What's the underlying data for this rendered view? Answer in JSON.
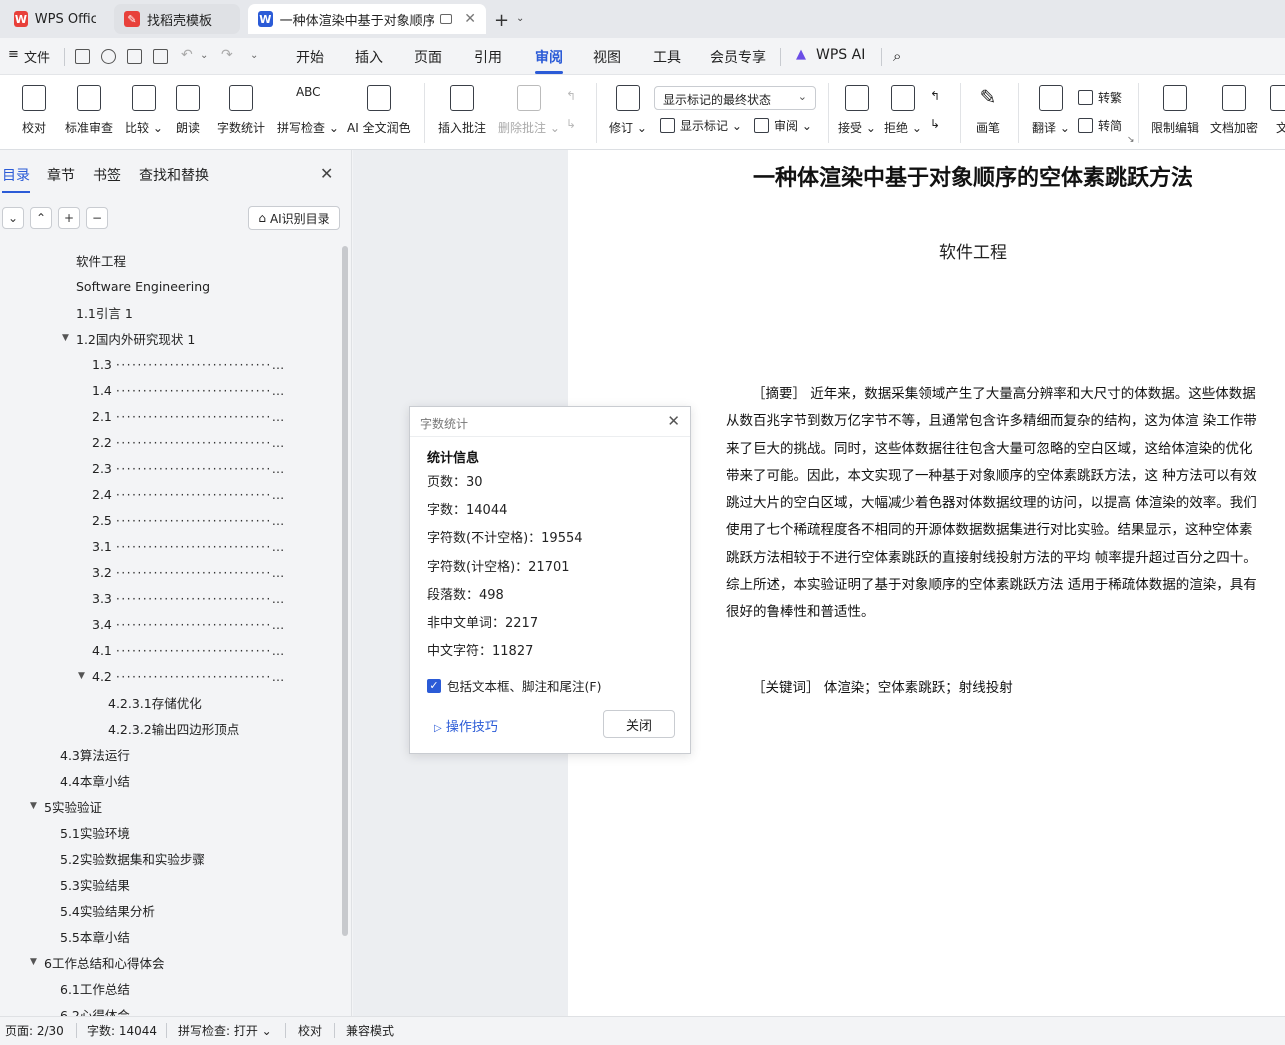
{
  "tabs": [
    {
      "label": "WPS Office"
    },
    {
      "label": "找稻壳模板"
    },
    {
      "label": "一种体渲染中基于对象顺序的"
    }
  ],
  "menu": {
    "file": "文件",
    "items": [
      "开始",
      "插入",
      "页面",
      "引用",
      "审阅",
      "视图",
      "工具",
      "会员专享",
      "WPS AI"
    ],
    "active": "审阅"
  },
  "ribbon": {
    "proofread": "校对",
    "standard_review": "标准审查",
    "compare": "比较",
    "read_aloud": "朗读",
    "word_count": "字数统计",
    "spell_check": "拼写检查",
    "ai_polish": "AI 全文润色",
    "insert_comment": "插入批注",
    "delete_comment": "删除批注",
    "track_changes": "修订",
    "markup_select": "显示标记的最终状态",
    "show_markup": "显示标记",
    "review_pane": "审阅",
    "accept": "接受",
    "reject": "拒绝",
    "pen": "画笔",
    "translate": "翻译",
    "to_traditional": "转繁",
    "to_simplified": "转简",
    "restrict_edit": "限制编辑",
    "encrypt": "文档加密",
    "more": "文"
  },
  "nav": {
    "tabs": [
      "目录",
      "章节",
      "书签",
      "查找和替换"
    ],
    "ai_toc": "AI识别目录"
  },
  "toc": [
    {
      "text": "软件工程",
      "indent": 1
    },
    {
      "text": "Software Engineering",
      "indent": 1
    },
    {
      "text": "1.1引言  1",
      "indent": 1
    },
    {
      "text": "1.2国内外研究现状  1",
      "indent": 1,
      "tri": "down"
    },
    {
      "text": "1.3",
      "indent": 2,
      "dots": true
    },
    {
      "text": "1.4",
      "indent": 2,
      "dots": true
    },
    {
      "text": "2.1",
      "indent": 2,
      "dots": true
    },
    {
      "text": "2.2",
      "indent": 2,
      "dots": true
    },
    {
      "text": "2.3",
      "indent": 2,
      "dots": true
    },
    {
      "text": "2.4",
      "indent": 2,
      "dots": true
    },
    {
      "text": "2.5",
      "indent": 2,
      "dots": true
    },
    {
      "text": "3.1",
      "indent": 2,
      "dots": true
    },
    {
      "text": "3.2",
      "indent": 2,
      "dots": true
    },
    {
      "text": "3.3",
      "indent": 2,
      "dots": true
    },
    {
      "text": "3.4",
      "indent": 2,
      "dots": true
    },
    {
      "text": "4.1",
      "indent": 2,
      "dots": true
    },
    {
      "text": "4.2",
      "indent": 2,
      "dots": true,
      "tri": "down"
    },
    {
      "text": "4.2.3.1存储优化",
      "indent": 3
    },
    {
      "text": "4.2.3.2输出四边形顶点",
      "indent": 3
    },
    {
      "text": "4.3算法运行",
      "indent": 0.5
    },
    {
      "text": "4.4本章小结",
      "indent": 0.5
    },
    {
      "text": "5实验验证",
      "indent": 0,
      "tri": "down"
    },
    {
      "text": "5.1实验环境",
      "indent": 0.5
    },
    {
      "text": "5.2实验数据集和实验步骤",
      "indent": 0.5
    },
    {
      "text": "5.3实验结果",
      "indent": 0.5
    },
    {
      "text": "5.4实验结果分析",
      "indent": 0.5
    },
    {
      "text": "5.5本章小结",
      "indent": 0.5
    },
    {
      "text": "6工作总结和心得体会",
      "indent": 0,
      "tri": "down"
    },
    {
      "text": "6.1工作总结",
      "indent": 0.5
    },
    {
      "text": "6.2心得体会",
      "indent": 0.5
    }
  ],
  "document": {
    "title": "一种体渲染中基于对象顺序的空体素跳跃方法",
    "subtitle": "软件工程",
    "abstract": "［摘要］ 近年来，数据采集领域产生了大量高分辨率和大尺寸的体数据。这些体数据从数百兆字节到数万亿字节不等，且通常包含许多精细而复杂的结构，这为体渲 染工作带来了巨大的挑战。同时，这些体数据往往包含大量可忽略的空白区域，这给体渲染的优化带来了可能。因此，本文实现了一种基于对象顺序的空体素跳跃方法，这 种方法可以有效跳过大片的空白区域，大幅减少着色器对体数据纹理的访问，以提高 体渲染的效率。我们使用了七个稀疏程度各不相同的开源体数据数据集进行对比实验。结果显示，这种空体素跳跃方法相较于不进行空体素跳跃的直接射线投射方法的平均 帧率提升超过百分之四十。综上所述，本实验证明了基于对象顺序的空体素跳跃方法 适用于稀疏体数据的渲染，具有很好的鲁棒性和普适性。",
    "keywords": "［关键词］ 体渲染；空体素跳跃；射线投射"
  },
  "dialog": {
    "title": "字数统计",
    "section": "统计信息",
    "rows": [
      {
        "label": "页数：",
        "value": "30"
      },
      {
        "label": "字数：",
        "value": "14044"
      },
      {
        "label": "字符数(不计空格)：",
        "value": "19554"
      },
      {
        "label": "字符数(计空格)：",
        "value": "21701"
      },
      {
        "label": "段落数：",
        "value": "498"
      },
      {
        "label": "非中文单词：",
        "value": "2217"
      },
      {
        "label": "中文字符：",
        "value": "11827"
      }
    ],
    "checkbox": "包括文本框、脚注和尾注(F)",
    "tips": "操作技巧",
    "close": "关闭"
  },
  "status": {
    "page": "页面: 2/30",
    "words": "字数: 14044",
    "spell": "拼写检查: 打开",
    "proof": "校对",
    "compat": "兼容模式"
  },
  "colors": {
    "accent": "#2b5bd7",
    "wps_red": "#e8403a"
  }
}
